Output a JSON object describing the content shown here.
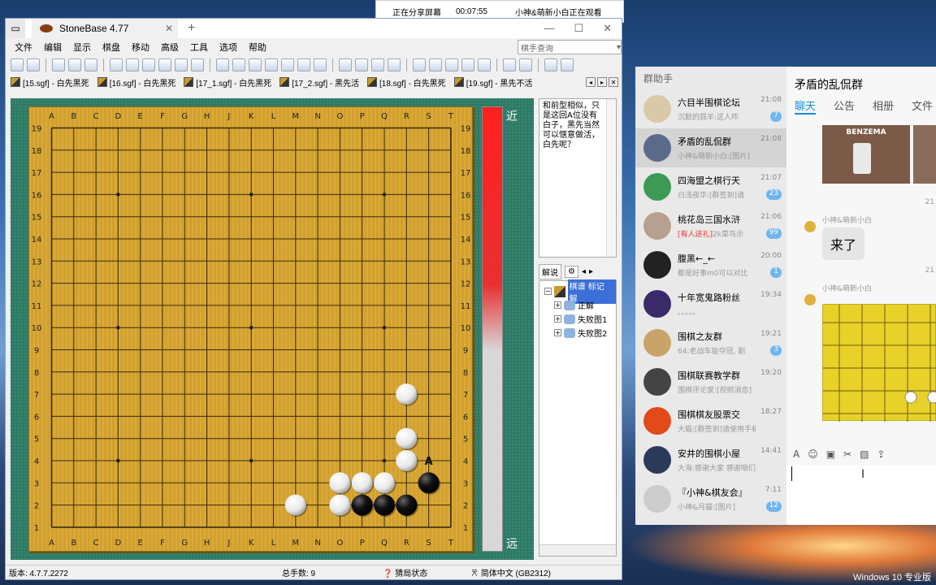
{
  "share_bar": {
    "sharing": "正在分享屏幕",
    "time": "00:07:55",
    "watcher": "小神&萌新小白正在观看"
  },
  "app": {
    "title": "StoneBase 4.77"
  },
  "menu": [
    "文件",
    "编辑",
    "显示",
    "棋盘",
    "移动",
    "高级",
    "工具",
    "选项",
    "帮助"
  ],
  "player_search": {
    "placeholder": "棋手查询"
  },
  "file_tabs": [
    "[15.sgf] - 白先黑死",
    "[16.sgf] - 白先黑死",
    "[17_1.sgf] - 白先黑死",
    "[17_2.sgf] - 黑先活",
    "[18.sgf] - 白先黑死",
    "[19.sgf] - 黑先不活"
  ],
  "board": {
    "columns": [
      "A",
      "B",
      "C",
      "D",
      "E",
      "F",
      "G",
      "H",
      "J",
      "K",
      "L",
      "M",
      "N",
      "O",
      "P",
      "Q",
      "R",
      "S",
      "T"
    ],
    "rows": [
      "19",
      "18",
      "17",
      "16",
      "15",
      "14",
      "13",
      "12",
      "11",
      "10",
      "9",
      "8",
      "7",
      "6",
      "5",
      "4",
      "3",
      "2",
      "1"
    ],
    "stones": [
      {
        "color": "white",
        "point": "R7"
      },
      {
        "color": "white",
        "point": "R5"
      },
      {
        "color": "white",
        "point": "R4"
      },
      {
        "color": "white",
        "point": "O3"
      },
      {
        "color": "white",
        "point": "P3"
      },
      {
        "color": "white",
        "point": "Q3"
      },
      {
        "color": "black",
        "point": "S3"
      },
      {
        "color": "white",
        "point": "M2"
      },
      {
        "color": "white",
        "point": "O2"
      },
      {
        "color": "black",
        "point": "P2"
      },
      {
        "color": "black",
        "point": "Q2"
      },
      {
        "color": "black",
        "point": "R2"
      }
    ],
    "marker": {
      "label": "A",
      "point": "S4"
    },
    "hoshi": [
      "D16",
      "K16",
      "Q16",
      "D10",
      "K10",
      "Q10",
      "D4",
      "K4",
      "Q4"
    ]
  },
  "eval": {
    "top_label": "近",
    "bottom_label": "远"
  },
  "comment": "和前型相似，只是这回A位没有白子，黑先当然可以惬意做活，白先呢？",
  "pane_tabs": {
    "commentary": "解说"
  },
  "tree": {
    "root": "棋谱 标记 解",
    "items": [
      "正解",
      "失败图1",
      "失败图2"
    ]
  },
  "status": {
    "version": "版本: 4.7.7.2272",
    "moves": "总手数: 9",
    "guess": "猜局状态",
    "lang": "简体中文 (GB2312)"
  },
  "qq": {
    "list_title": "群助手",
    "chats": [
      {
        "name": "六目半围棋论坛",
        "time": "21:08",
        "msg": "沉默的蒜羊:这人咋",
        "badge": "7",
        "avatar": "#d9c9a8"
      },
      {
        "name": "矛盾的乱侃群",
        "time": "21:08",
        "msg": "小神&萌新小白:[图片]",
        "badge": "",
        "avatar": "#5a6a8a",
        "active": true
      },
      {
        "name": "四海盟之棋行天",
        "time": "21:07",
        "msg": "白浅夜华:[群签到]请",
        "badge": "23",
        "avatar": "#3c9a56"
      },
      {
        "name": "桃花岛三国水浒",
        "time": "21:06",
        "msg": "2k菜鸟示",
        "prefix": "[有人送礼]",
        "badge": "99",
        "avatar": "#b8a090"
      },
      {
        "name": "腹黑←_←",
        "time": "20:00",
        "msg": "都是好事m0可以对比",
        "badge": "1",
        "avatar": "#222222"
      },
      {
        "name": "十年宽鬼路粉丝",
        "time": "19:34",
        "msg": "。。。。。",
        "badge": "",
        "avatar": "#3a2a6a"
      },
      {
        "name": "围棋之友群",
        "time": "19:21",
        "msg": "64:老战车能夺冠, 剧",
        "badge": "3",
        "avatar": "#c9a46a"
      },
      {
        "name": "围棋联赛教学群",
        "time": "19:20",
        "msg": "围棋评论家:[视频消息]",
        "badge": "",
        "avatar": "#444444"
      },
      {
        "name": "围棋棋友股票交",
        "time": "18:27",
        "msg": "大猫:[群签到]请使用手机",
        "badge": "",
        "avatar": "#e24a1a"
      },
      {
        "name": "安井的围棋小屋",
        "time": "14:41",
        "msg": "大海:感谢大家 感谢咱们群",
        "badge": "",
        "avatar": "#2a3a5a"
      },
      {
        "name": "『小神&棋友会』",
        "time": "7:11",
        "msg": "小神&月猫:[图片]",
        "badge": "12",
        "avatar": "#cccccc"
      }
    ],
    "chat_title": "矛盾的乱侃群",
    "tabs": [
      "聊天",
      "公告",
      "相册",
      "文件"
    ],
    "benzema": "BENZEMA",
    "sender": "小神&萌新小白",
    "message": "来了",
    "time_frag": "21"
  },
  "os": {
    "edition": "Windows 10 专业版"
  }
}
